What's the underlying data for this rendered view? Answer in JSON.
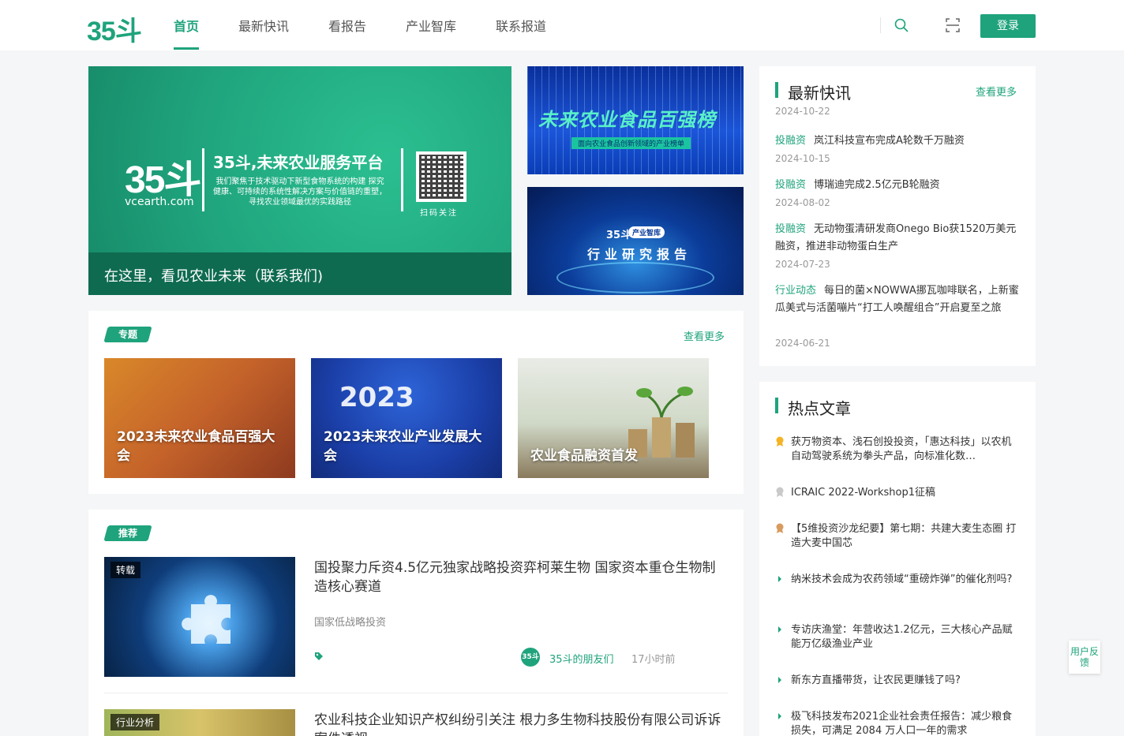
{
  "header": {
    "logo": "35斗",
    "nav": [
      "首页",
      "最新快讯",
      "看报告",
      "产业智库",
      "联系报道"
    ],
    "login": "登录"
  },
  "hero": {
    "logo": "35斗",
    "site": "vcearth.com",
    "title": "35斗,未来农业服务平台",
    "desc": "我们聚焦于技术驱动下新型食物系统的构建 探究健康、可持续的系统性解决方案与价值链的重塑，寻找农业领域最优的实践路径",
    "qr_label": "扫码关注",
    "caption": "在这里，看见农业未来（联系我们)"
  },
  "banner_top": {
    "title": "未来农业食品百强榜",
    "subtitle": "面向农业食品创新领域的产业榜单"
  },
  "banner_bottom": {
    "brand": "35斗",
    "tag": "产业智库",
    "title": "行业研究报告"
  },
  "topics": {
    "badge": "专题",
    "more": "查看更多",
    "items": [
      {
        "title": "2023未来农业食品百强大会"
      },
      {
        "title": "2023未来农业产业发展大会"
      },
      {
        "title": "农业食品融资首发"
      }
    ]
  },
  "recommend": {
    "badge": "推荐",
    "items": [
      {
        "label": "转载",
        "title": "国投聚力斥资4.5亿元独家战略投资弈柯莱生物 国家资本重仓生物制造核心赛道",
        "source": "国家低战略投资",
        "avatar": "35斗",
        "author": "35斗的朋友们",
        "time": "17小时前"
      },
      {
        "label": "行业分析",
        "title": "农业科技企业知识产权纠纷引关注 根力多生物科技股份有限公司诉诉案件透视"
      }
    ]
  },
  "flash": {
    "title": "最新快讯",
    "more": "查看更多",
    "top_date": "2024-10-22",
    "items": [
      {
        "cat": "投融资",
        "text": "岚江科技宣布完成A轮数千万融资",
        "date": "2024-10-15"
      },
      {
        "cat": "投融资",
        "text": "博瑞迪完成2.5亿元B轮融资",
        "date": "2024-08-02"
      },
      {
        "cat": "投融资",
        "text": "无动物蛋清研发商Onego Bio获1520万美元融资，推进非动物蛋白生产",
        "date": "2024-07-23"
      },
      {
        "cat": "行业动态",
        "text": "每日的菌×NOWWA挪瓦咖啡联名，上新蜜瓜美式与活菌嘣片“打工人唤醒组合”开启夏至之旅",
        "date": "2024-06-21"
      }
    ]
  },
  "hot": {
    "title": "热点文章",
    "items": [
      "获万物资本、浅石创投投资，「惠达科技」以农机自动驾驶系统为拳头产品，向标准化数…",
      "ICRAIC 2022-Workshop1征稿",
      "【5维投资沙龙纪要】第七期：共建大麦生态圈 打造大麦中国芯",
      "纳米技术会成为农药领域“重磅炸弹”的催化剂吗?",
      "专访庆渔堂：年营收达1.2亿元，三大核心产品赋能万亿级渔业产业",
      "新东方直播带货，让农民更赚钱了吗?",
      "极飞科技发布2021企业社会责任报告：减少粮食损失，可满足 2084 万人口一年的需求"
    ]
  },
  "feedback": "用户反馈",
  "colors": {
    "brand": "#1fa37c",
    "gold": "#f5b324",
    "silver": "#c9c9c9",
    "bronze": "#d99b5e"
  }
}
